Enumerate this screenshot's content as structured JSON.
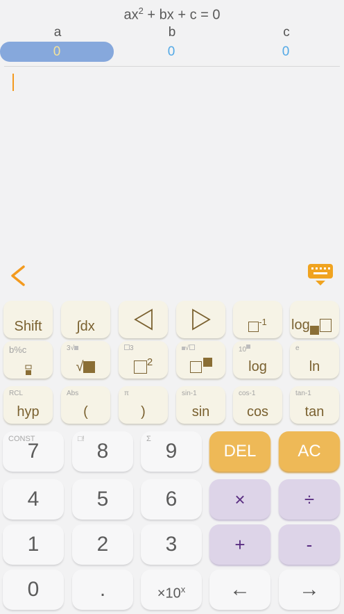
{
  "equation": {
    "prefix": "ax",
    "sup": "2",
    "suffix": " + bx + c = 0"
  },
  "coefficients": [
    {
      "label": "a",
      "value": "0",
      "selected": true
    },
    {
      "label": "b",
      "value": "0",
      "selected": false
    },
    {
      "label": "c",
      "value": "0",
      "selected": false
    }
  ],
  "sci_keys": {
    "shift": {
      "main": "Shift"
    },
    "integral": {
      "main": "∫dx"
    },
    "reciprocal": {
      "main": "-1"
    },
    "log_base": {
      "main": "log"
    },
    "fraction": {
      "top": "b%c"
    },
    "sqrt": {
      "top": "3",
      "main": "√"
    },
    "square": {
      "top": "3",
      "main": "2"
    },
    "nth_root": {},
    "log": {
      "top": "10",
      "main": "log"
    },
    "ln": {
      "top": "e",
      "main": "ln"
    },
    "hyp": {
      "top": "RCL",
      "main": "hyp"
    },
    "lparen": {
      "top": "Abs",
      "main": "("
    },
    "rparen": {
      "top": "π",
      "main": ")"
    },
    "sin": {
      "top": "sin-1",
      "main": "sin"
    },
    "cos": {
      "top": "cos-1",
      "main": "cos"
    },
    "tan": {
      "top": "tan-1",
      "main": "tan"
    }
  },
  "num_keys": {
    "k7": {
      "top": "CONST",
      "main": "7"
    },
    "k8": {
      "top": "□!",
      "main": "8"
    },
    "k9": {
      "top": "Σ",
      "main": "9"
    },
    "del": {
      "main": "DEL"
    },
    "ac": {
      "main": "AC"
    },
    "k4": {
      "main": "4"
    },
    "k5": {
      "main": "5"
    },
    "k6": {
      "main": "6"
    },
    "mul": {
      "main": "×"
    },
    "div": {
      "main": "÷"
    },
    "k1": {
      "main": "1"
    },
    "k2": {
      "main": "2"
    },
    "k3": {
      "main": "3"
    },
    "plus": {
      "main": "+"
    },
    "minus": {
      "main": "-"
    },
    "k0": {
      "main": "0"
    },
    "dot": {
      "main": "."
    },
    "exp": {
      "main": "×10",
      "sup": "x"
    },
    "left": {
      "main": "←"
    },
    "right": {
      "main": "→"
    }
  }
}
